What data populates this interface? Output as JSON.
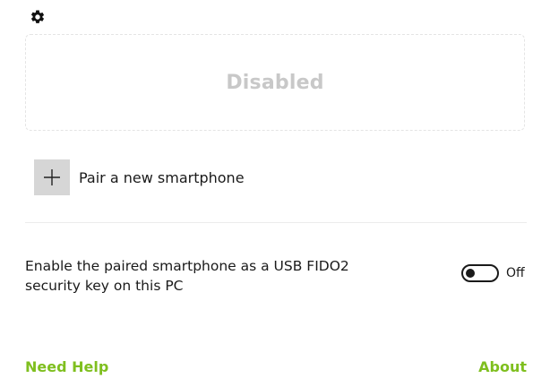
{
  "header": {
    "settings_icon": "gear-icon"
  },
  "status": {
    "text": "Disabled",
    "color": "#c8c8c8"
  },
  "pair": {
    "icon": "plus-icon",
    "label": "Pair a new smartphone"
  },
  "usb_fido": {
    "description": "Enable the paired smartphone as a USB FIDO2 security key on this PC",
    "toggle_state": "Off",
    "enabled": false
  },
  "footer": {
    "help_label": "Need Help",
    "about_label": "About",
    "link_color": "#7fbf1f"
  }
}
